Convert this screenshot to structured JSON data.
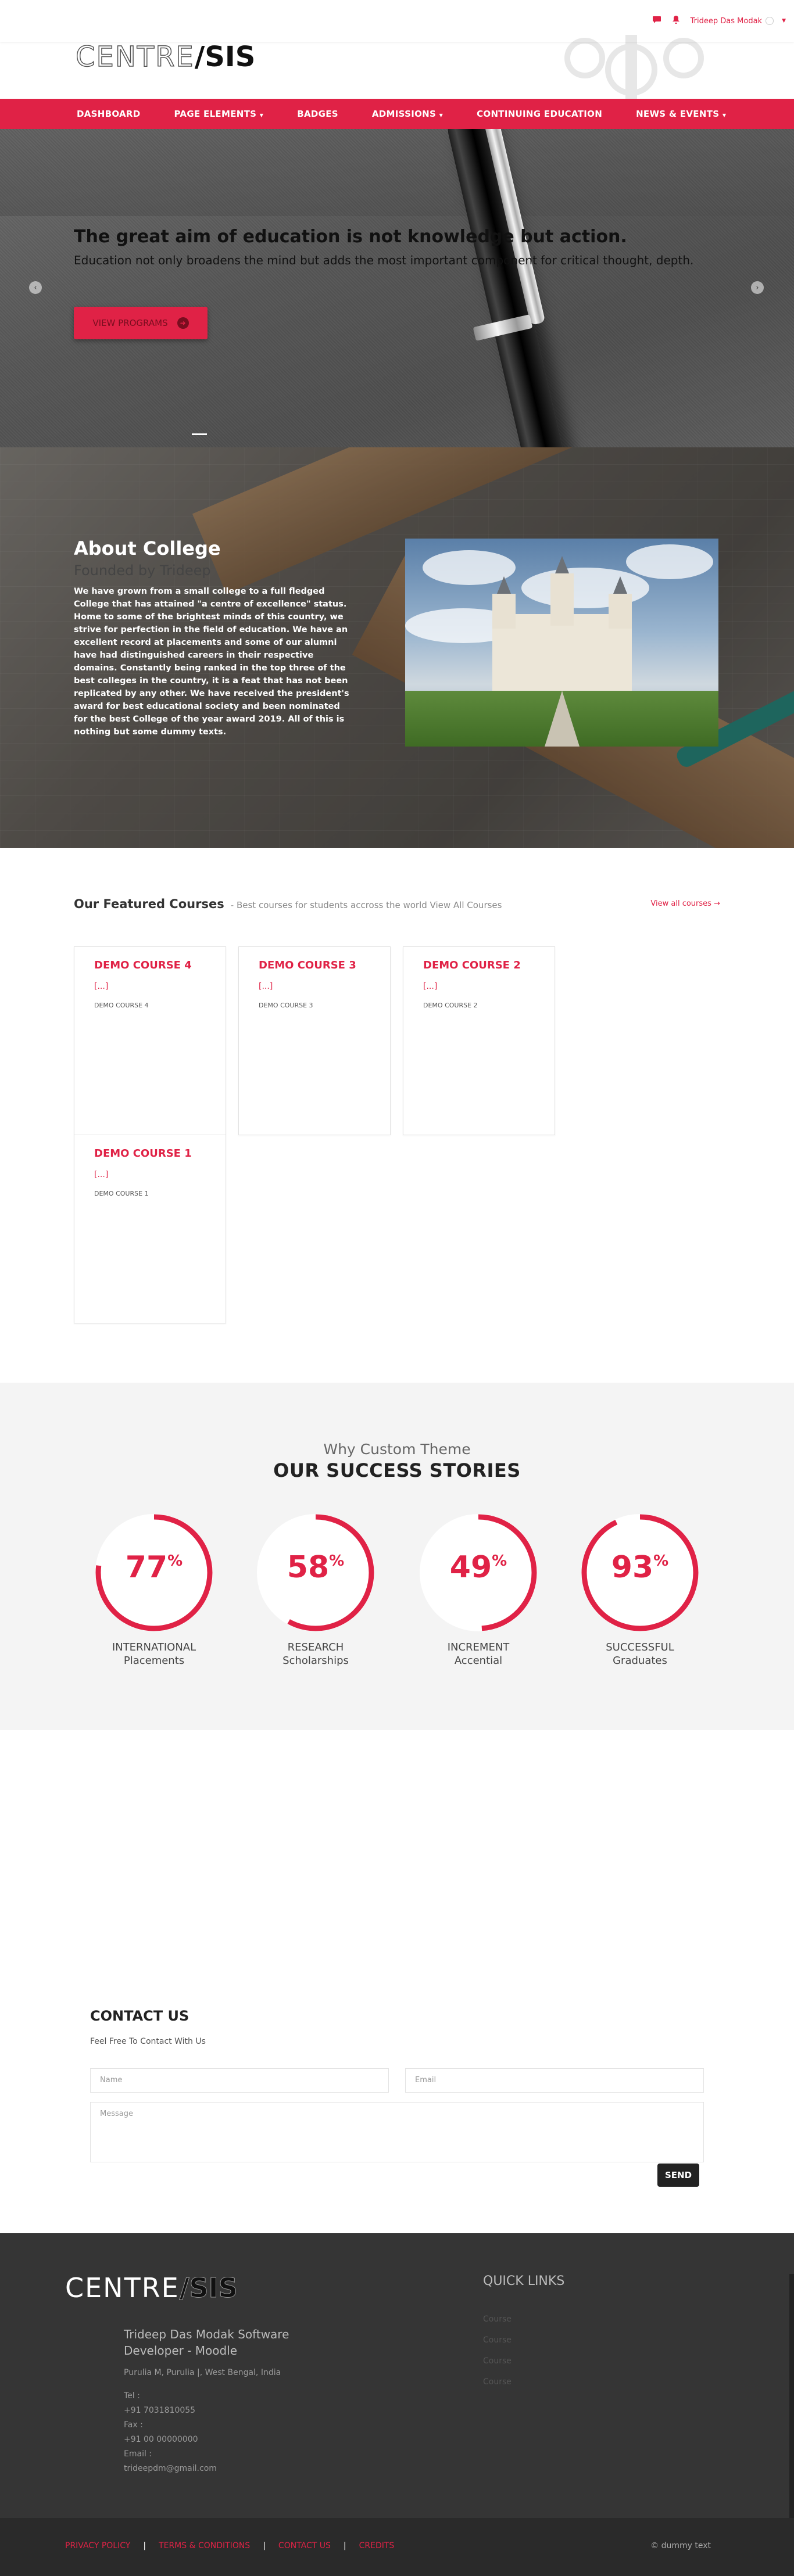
{
  "topbar": {
    "user_name": "Trideep Das Modak"
  },
  "brand": {
    "logo_part1": "CENTRE",
    "logo_part2": "/SIS",
    "accent_color": "#e02246"
  },
  "nav": {
    "items": [
      {
        "label": "DASHBOARD",
        "has_dropdown": false
      },
      {
        "label": "PAGE ELEMENTS",
        "has_dropdown": true
      },
      {
        "label": "BADGES",
        "has_dropdown": false
      },
      {
        "label": "ADMISSIONS",
        "has_dropdown": true
      },
      {
        "label": "CONTINUING EDUCATION",
        "has_dropdown": false
      },
      {
        "label": "NEWS & EVENTS",
        "has_dropdown": true
      }
    ]
  },
  "hero": {
    "title": "The great aim of education is not knowledge but action.",
    "subtitle": "Education not only broadens the mind but adds the most important component for critical thought, depth.",
    "button_label": "VIEW PROGRAMS",
    "prev_icon": "chevron-left-icon",
    "next_icon": "chevron-right-icon"
  },
  "about": {
    "title": "About College",
    "founded": "Founded by Trideep",
    "text": "We have grown from a small college to a full fledged College that has attained \"a centre of excellence\" status. Home to some of the brightest minds of this country, we strive for perfection in the field of education. We have an excellent record at placements and some of our alumni have had distinguished careers in their respective domains. Constantly being ranked in the top three of the best colleges in the country, it is a feat that has not been replicated by any other. We have received the president's award for best educational society and been nominated for the best College of the year award 2019. All of this is nothing but some dummy texts."
  },
  "featured": {
    "title": "Our Featured Courses",
    "subtitle": "- Best courses for students accross the world View All Courses",
    "view_all": "View all courses",
    "courses": [
      {
        "name": "DEMO COURSE 4",
        "summary": "[...]",
        "category": "DEMO COURSE 4"
      },
      {
        "name": "DEMO COURSE 3",
        "summary": "[...]",
        "category": "DEMO COURSE 3"
      },
      {
        "name": "DEMO COURSE 2",
        "summary": "[...]",
        "category": "DEMO COURSE 2"
      },
      {
        "name": "DEMO COURSE 1",
        "summary": "[...]",
        "category": "DEMO COURSE 1"
      }
    ]
  },
  "stories": {
    "why": "Why Custom Theme",
    "title": "OUR SUCCESS STORIES",
    "items": [
      {
        "value": "77",
        "unit": "%",
        "line1": "INTERNATIONAL",
        "line2": "Placements"
      },
      {
        "value": "58",
        "unit": "%",
        "line1": "RESEARCH",
        "line2": "Scholarships"
      },
      {
        "value": "49",
        "unit": "%",
        "line1": "INCREMENT",
        "line2": "Accential"
      },
      {
        "value": "93",
        "unit": "%",
        "line1": "SUCCESSFUL",
        "line2": "Graduates"
      }
    ]
  },
  "contact": {
    "title": "CONTACT US",
    "subtitle": "Feel Free To Contact With Us",
    "name_placeholder": "Name",
    "email_placeholder": "Email",
    "message_placeholder": "Message",
    "send_label": "SEND"
  },
  "footer": {
    "logo_part1": "CENTRE",
    "logo_part2": "/SIS",
    "company": "Trideep Das Modak Software Developer - Moodle",
    "address": "Purulia M, Purulia |, West Bengal, India",
    "tel_label": "Tel :",
    "tel": "+91 7031810055",
    "fax_label": "Fax :",
    "fax": "+91 00 00000000",
    "email_label": "Email :",
    "email": "trideepdm@gmail.com",
    "quick_links_title": "QUICK LINKS",
    "quick_links": [
      "Course",
      "Course",
      "Course",
      "Course"
    ]
  },
  "bottom": {
    "links": [
      "PRIVACY POLICY",
      "TERMS & CONDITIONS",
      "CONTACT US",
      "CREDITS"
    ],
    "copyright": "© dummy text"
  }
}
